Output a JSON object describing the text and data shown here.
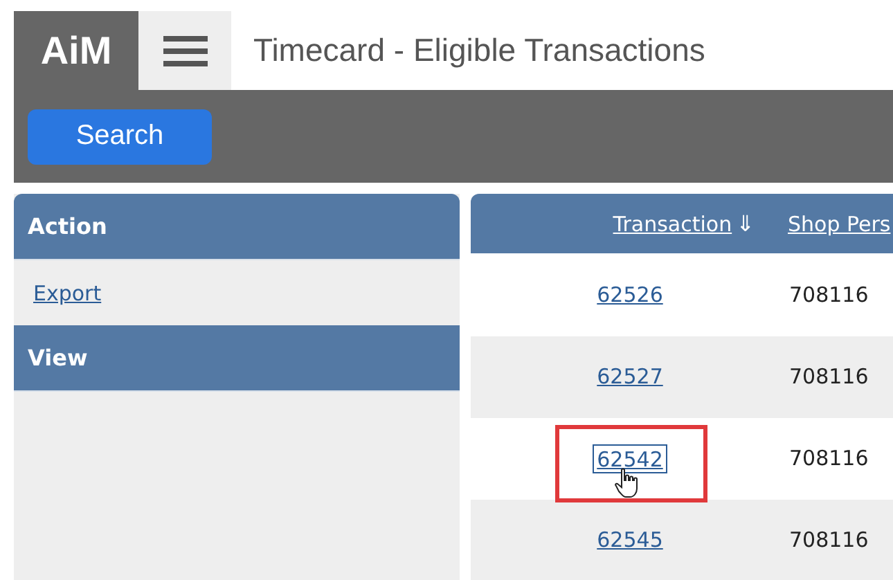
{
  "header": {
    "logo": "AiM",
    "title": "Timecard - Eligible Transactions"
  },
  "toolbar": {
    "buttons": [
      "Search"
    ]
  },
  "sidebar": {
    "sections": [
      {
        "title": "Action",
        "items": [
          "Export"
        ]
      },
      {
        "title": "View"
      }
    ]
  },
  "table": {
    "columns": [
      {
        "label": "Transaction",
        "sort_icon": "⇓"
      },
      {
        "label": "Shop Pers"
      }
    ],
    "rows": [
      {
        "transaction": "62526",
        "shop_person": "708116",
        "highlighted": false
      },
      {
        "transaction": "62527",
        "shop_person": "708116",
        "highlighted": false
      },
      {
        "transaction": "62542",
        "shop_person": "708116",
        "highlighted": true
      },
      {
        "transaction": "62545",
        "shop_person": "708116",
        "highlighted": false
      }
    ]
  }
}
